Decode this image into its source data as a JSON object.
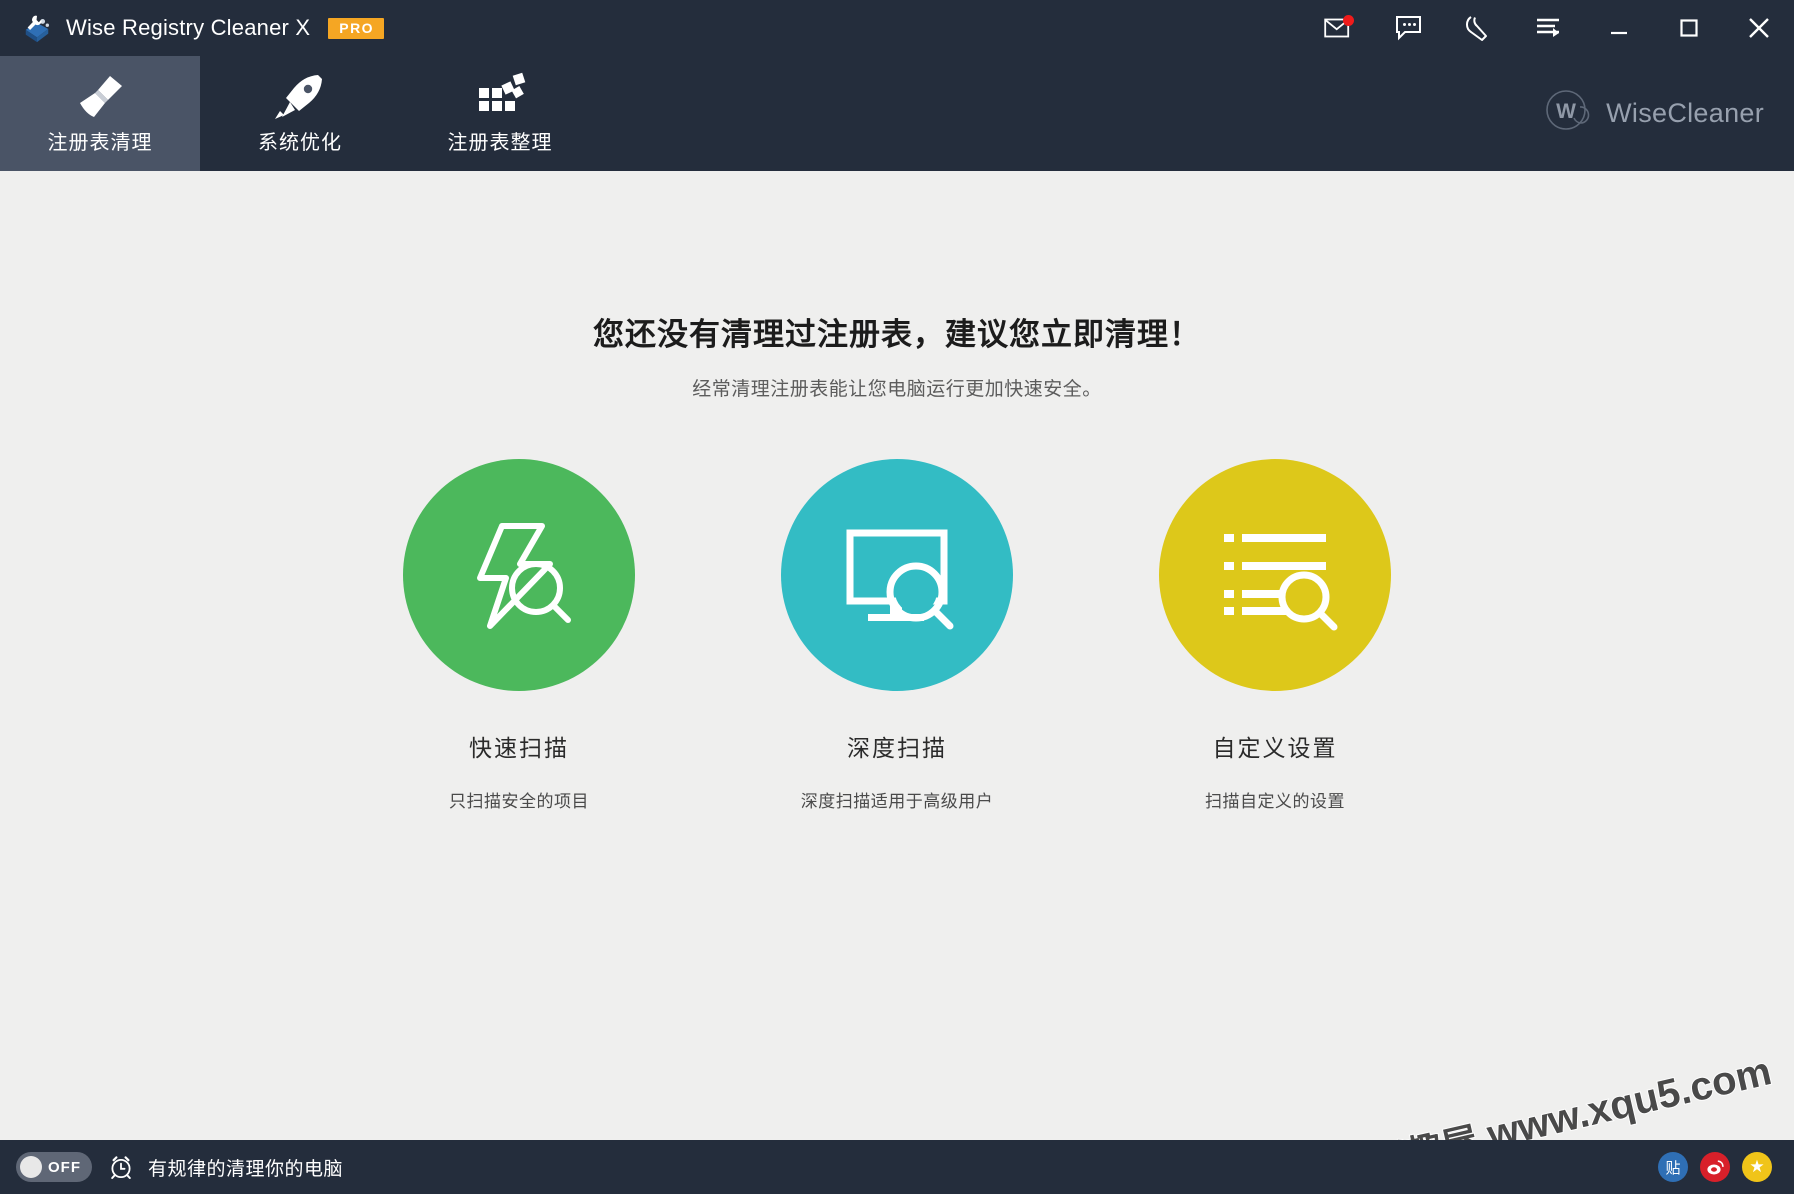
{
  "window": {
    "app_title": "Wise Registry Cleaner X",
    "pro_badge": "PRO",
    "logo_icon": "wise-registry-cleaner-logo",
    "controls": [
      {
        "name": "mail-icon",
        "label": "",
        "has_badge": true
      },
      {
        "name": "feedback-icon",
        "label": "",
        "has_badge": false
      },
      {
        "name": "wrench-icon",
        "label": "",
        "has_badge": false
      },
      {
        "name": "menu-icon",
        "label": "",
        "has_badge": false
      },
      {
        "name": "minimize-button",
        "label": "",
        "has_badge": false
      },
      {
        "name": "maximize-button",
        "label": "",
        "has_badge": false
      },
      {
        "name": "close-button",
        "label": "",
        "has_badge": false
      }
    ],
    "colors": {
      "titlebar_bg": "#242d3c",
      "nav_active_bg": "#4a5466",
      "content_bg": "#efefee",
      "pro_badge": "#f5a623",
      "badge_dot": "#f01b1b"
    }
  },
  "nav": {
    "tabs": [
      {
        "label": "注册表清理",
        "icon": "broom-icon",
        "active": true
      },
      {
        "label": "系统优化",
        "icon": "rocket-icon",
        "active": false
      },
      {
        "label": "注册表整理",
        "icon": "blocks-icon",
        "active": false
      }
    ],
    "brand": {
      "text": "WiseCleaner",
      "icon": "wisecleaner-w-logo"
    }
  },
  "main": {
    "headline": "您还没有清理过注册表，建议您立即清理！",
    "subline": "经常清理注册表能让您电脑运行更加快速安全。",
    "cards": [
      {
        "title": "快速扫描",
        "desc": "只扫描安全的项目",
        "color": "#4cb85c",
        "icon": "lightning-search-icon"
      },
      {
        "title": "深度扫描",
        "desc": "深度扫描适用于高级用户",
        "color": "#33bcc4",
        "icon": "monitor-search-icon"
      },
      {
        "title": "自定义设置",
        "desc": "扫描自定义的设置",
        "color": "#ddc81a",
        "icon": "list-search-icon"
      }
    ]
  },
  "watermark": {
    "cn": "兴趣屋",
    "url": "www.xqu5.com"
  },
  "statusbar": {
    "toggle_state": "OFF",
    "clock_icon": "alarm-clock-icon",
    "text": "有规律的清理你的电脑",
    "social": [
      {
        "name": "tieba-icon",
        "glyph": "贴",
        "color": "#2f6fb5"
      },
      {
        "name": "weibo-icon",
        "glyph": "",
        "color": "#d8202a"
      },
      {
        "name": "qzone-icon",
        "glyph": "★",
        "color": "#f0c419"
      }
    ]
  }
}
